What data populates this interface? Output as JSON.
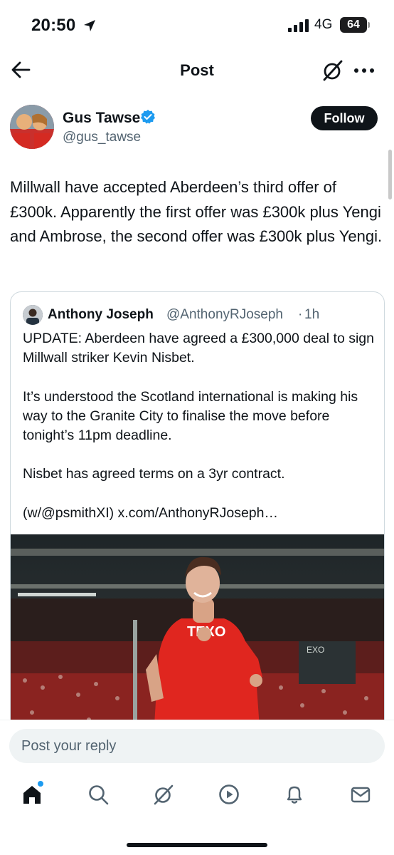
{
  "status_bar": {
    "time": "20:50",
    "network": "4G",
    "battery": "64"
  },
  "nav": {
    "title": "Post"
  },
  "post": {
    "author_name": "Gus Tawse",
    "author_handle": "@gus_tawse",
    "follow_label": "Follow",
    "text": "Millwall have accepted Aberdeen’s third offer of £300k. Apparently the first offer was £300k plus Yengi and Ambrose, the second offer was £300k plus Yengi."
  },
  "quote": {
    "author_name": "Anthony Joseph",
    "author_handle": "@AnthonyRJoseph",
    "separator": "·",
    "time": "1h",
    "paragraphs": [
      "UPDATE: Aberdeen have agreed a £300,000 deal to sign Millwall striker Kevin Nisbet.",
      "It’s understood the Scotland international is making his way to the Granite City to finalise the move before tonight’s 11pm deadline.",
      "Nisbet has agreed terms on a 3yr contract.",
      "(w/@psmithXI) x.com/AnthonyRJoseph…"
    ],
    "image_shirt_text": "TEXO",
    "image_board_text": "EXO"
  },
  "reply": {
    "placeholder": "Post your reply"
  },
  "tabbar": {
    "items": [
      "home-icon",
      "search-icon",
      "grok-icon",
      "video-icon",
      "notifications-icon",
      "messages-icon"
    ],
    "active": "home-icon"
  },
  "colors": {
    "accent": "#1d9bf0",
    "text": "#0f1419",
    "secondary": "#536471",
    "aberdeen_red": "#e0261f"
  }
}
